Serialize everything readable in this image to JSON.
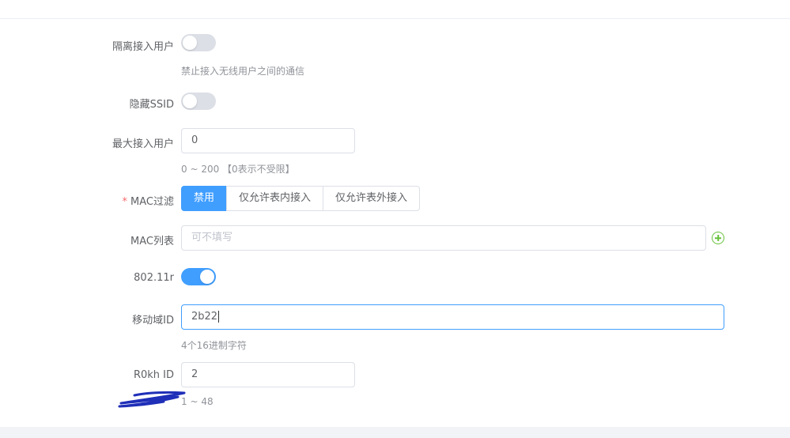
{
  "form": {
    "isolate_users": {
      "label": "隔离接入用户",
      "on": false,
      "hint": "禁止接入无线用户之间的通信"
    },
    "hide_ssid": {
      "label": "隐藏SSID",
      "on": false
    },
    "max_users": {
      "label": "最大接入用户",
      "value": "0",
      "hint": "0 ~ 200 【0表示不受限】"
    },
    "mac_filter": {
      "required_mark": "*",
      "label": "MAC过滤",
      "options": [
        "禁用",
        "仅允许表内接入",
        "仅允许表外接入"
      ],
      "selected": "禁用"
    },
    "mac_list": {
      "label": "MAC列表",
      "placeholder": "可不填写",
      "add_icon": "plus-circle-icon"
    },
    "dot11r": {
      "label": "802.11r",
      "on": true
    },
    "mobility_domain_id": {
      "label": "移动域ID",
      "value": "2b22",
      "hint": "4个16进制字符"
    },
    "r0kh_id": {
      "label": "R0kh ID",
      "value": "2",
      "hint": "1 ~ 48"
    }
  },
  "colors": {
    "primary": "#409eff",
    "add": "#67c23a",
    "required": "#f56c6c",
    "scribble": "#1f2fb8"
  }
}
